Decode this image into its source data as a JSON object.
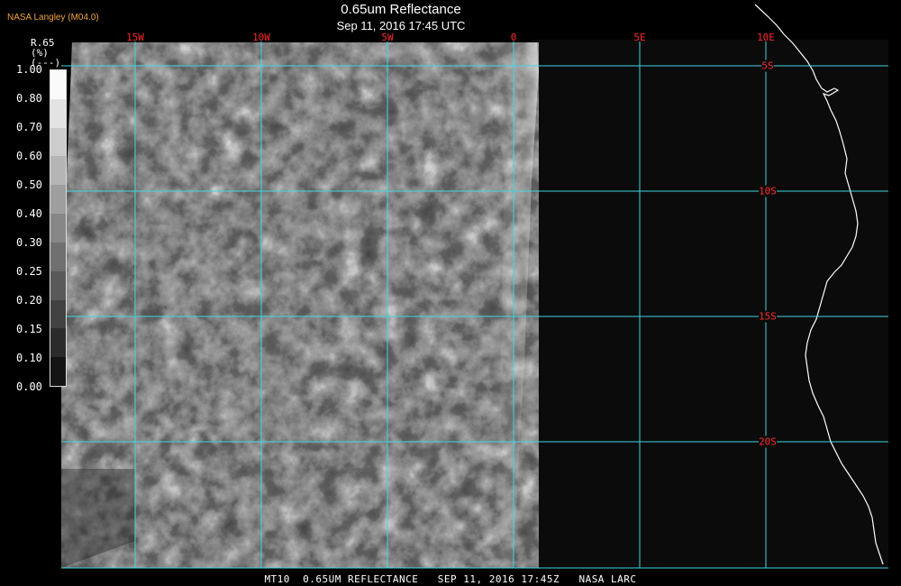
{
  "header": {
    "agency": "NASA Langley (M04.0)",
    "title": "0.65um Reflectance",
    "subtitle": "Sep 11, 2016 17:45 UTC"
  },
  "map": {
    "longitudes": [
      {
        "label": "15W",
        "value": -15
      },
      {
        "label": "10W",
        "value": -10
      },
      {
        "label": "5W",
        "value": -5
      },
      {
        "label": "0",
        "value": 0
      },
      {
        "label": "5E",
        "value": 5
      },
      {
        "label": "10E",
        "value": 10
      }
    ],
    "latitudes": [
      {
        "label": "5S",
        "value": -5
      },
      {
        "label": "10S",
        "value": -10
      },
      {
        "label": "15S",
        "value": -15
      },
      {
        "label": "20S",
        "value": -20
      }
    ],
    "grid_color": "#3fd6e0",
    "label_color": "#ff2a2a",
    "coast_color": "#ffffff"
  },
  "colorbar": {
    "title_lines": [
      "R.65",
      "(%)",
      "(---)"
    ],
    "ticks": [
      "1.00",
      "0.80",
      "0.70",
      "0.60",
      "0.50",
      "0.40",
      "0.30",
      "0.25",
      "0.20",
      "0.15",
      "0.10",
      "0.00"
    ],
    "min": 0.0,
    "max": 1.0
  },
  "footer": {
    "text": "MT10  0.65UM REFLECTANCE   SEP 11, 2016 17:45Z   NASA LARC"
  }
}
